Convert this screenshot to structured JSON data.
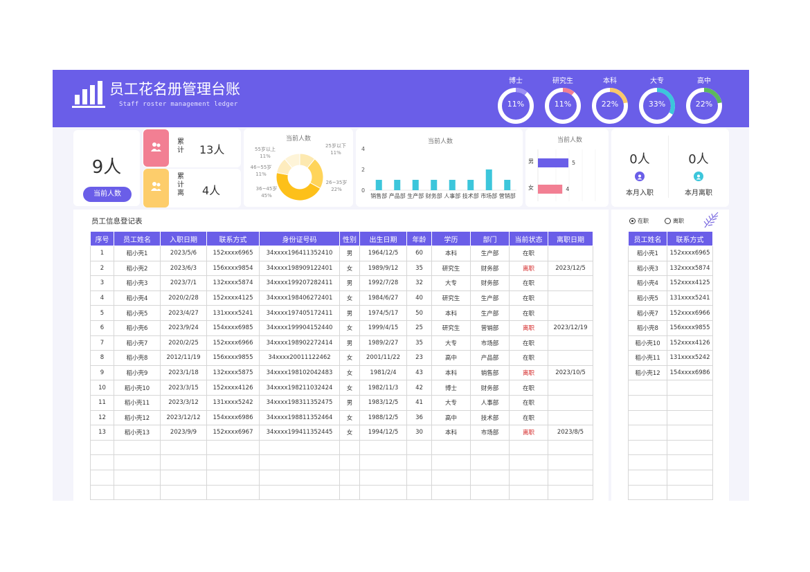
{
  "header": {
    "title": "员工花名册管理台账",
    "subtitle": "Staff roster management ledger"
  },
  "education": [
    {
      "label": "博士",
      "pct_text": "11%",
      "pct": 0.11,
      "color": "#9c8ff5"
    },
    {
      "label": "研究生",
      "pct_text": "11%",
      "pct": 0.11,
      "color": "#f27f93"
    },
    {
      "label": "本科",
      "pct_text": "22%",
      "pct": 0.22,
      "color": "#f9c86a"
    },
    {
      "label": "大专",
      "pct_text": "33%",
      "pct": 0.33,
      "color": "#3cc6db"
    },
    {
      "label": "高中",
      "pct_text": "22%",
      "pct": 0.22,
      "color": "#5cb85c"
    }
  ],
  "summary": {
    "current_count": "9人",
    "current_label": "当前人数",
    "cum_label": "累计",
    "cum_value": "13人",
    "cum_left_label": "累计离",
    "cum_left_value": "4人",
    "month_join_value": "0人",
    "month_join_label": "本月入职",
    "month_leave_value": "0人",
    "month_leave_label": "本月离职"
  },
  "colors": {
    "accent": "#6a5ee8",
    "pink": "#f27f93",
    "yellow": "#fdcd6b",
    "cyan": "#3cc6db",
    "resign": "#d21f1f"
  },
  "age_chart": {
    "title": "当前人数",
    "labels": [
      {
        "name": "55岁以上",
        "pct": "11%"
      },
      {
        "name": "46~55岁",
        "pct": "11%"
      },
      {
        "name": "36~45岁",
        "pct": "45%"
      },
      {
        "name": "26~35岁",
        "pct": "22%"
      },
      {
        "name": "25岁以下",
        "pct": "11%"
      }
    ]
  },
  "chart_data": [
    {
      "type": "pie",
      "title": "当前人数",
      "categories": [
        "25岁以下",
        "26~35岁",
        "36~45岁",
        "46~55岁",
        "55岁以上"
      ],
      "values": [
        11,
        22,
        45,
        11,
        11
      ]
    },
    {
      "type": "bar",
      "title": "当前人数",
      "categories": [
        "销售部",
        "产品部",
        "生产部",
        "财务部",
        "人事部",
        "技术部",
        "市场部",
        "营销部"
      ],
      "values": [
        1,
        1,
        1,
        1,
        1,
        1,
        2,
        1
      ],
      "ylim": [
        0,
        4
      ],
      "yticks": [
        "0",
        "2",
        "4"
      ],
      "color": "#3cc6db"
    },
    {
      "type": "bar",
      "title": "当前人数",
      "categories": [
        "男",
        "女"
      ],
      "values": [
        5,
        4
      ],
      "colors": [
        "#6a5ee8",
        "#f27f93"
      ],
      "orientation": "horizontal"
    }
  ],
  "register": {
    "title": "员工信息登记表",
    "columns": [
      "序号",
      "员工姓名",
      "入职日期",
      "联系方式",
      "身份证号码",
      "性别",
      "出生日期",
      "年龄",
      "学历",
      "部门",
      "当前状态",
      "离职日期"
    ],
    "rows": [
      [
        "1",
        "稻小壳1",
        "2023/5/6",
        "152xxxx6965",
        "34xxxx196411352410",
        "男",
        "1964/12/5",
        "60",
        "本科",
        "生产部",
        "在职",
        ""
      ],
      [
        "2",
        "稻小壳2",
        "2023/6/3",
        "156xxxx9854",
        "34xxxx198909122401",
        "女",
        "1989/9/12",
        "35",
        "研究生",
        "财务部",
        "离职",
        "2023/12/5"
      ],
      [
        "3",
        "稻小壳3",
        "2023/7/1",
        "132xxxx5874",
        "34xxxx199207282411",
        "男",
        "1992/7/28",
        "32",
        "大专",
        "财务部",
        "在职",
        ""
      ],
      [
        "4",
        "稻小壳4",
        "2020/2/28",
        "152xxxx4125",
        "34xxxx198406272401",
        "女",
        "1984/6/27",
        "40",
        "研究生",
        "生产部",
        "在职",
        ""
      ],
      [
        "5",
        "稻小壳5",
        "2023/4/27",
        "131xxxx5241",
        "34xxxx197405172411",
        "男",
        "1974/5/17",
        "50",
        "本科",
        "生产部",
        "在职",
        ""
      ],
      [
        "6",
        "稻小壳6",
        "2023/9/24",
        "154xxxx6985",
        "34xxxx199904152440",
        "女",
        "1999/4/15",
        "25",
        "研究生",
        "营销部",
        "离职",
        "2023/12/19"
      ],
      [
        "7",
        "稻小壳7",
        "2020/2/25",
        "152xxxx6966",
        "34xxxx198902272414",
        "男",
        "1989/2/27",
        "35",
        "大专",
        "市场部",
        "在职",
        ""
      ],
      [
        "8",
        "稻小壳8",
        "2012/11/19",
        "156xxxx9855",
        "34xxxx20011122462",
        "女",
        "2001/11/22",
        "23",
        "高中",
        "产品部",
        "在职",
        ""
      ],
      [
        "9",
        "稻小壳9",
        "2023/1/18",
        "132xxxx5875",
        "34xxxx198102042483",
        "女",
        "1981/2/4",
        "43",
        "本科",
        "销售部",
        "离职",
        "2023/10/5"
      ],
      [
        "10",
        "稻小壳10",
        "2023/3/15",
        "152xxxx4126",
        "34xxxx198211032424",
        "女",
        "1982/11/3",
        "42",
        "博士",
        "财务部",
        "在职",
        ""
      ],
      [
        "11",
        "稻小壳11",
        "2023/3/12",
        "131xxxx5242",
        "34xxxx198311352475",
        "男",
        "1983/12/5",
        "41",
        "大专",
        "人事部",
        "在职",
        ""
      ],
      [
        "12",
        "稻小壳12",
        "2023/12/12",
        "154xxxx6986",
        "34xxxx198811352464",
        "女",
        "1988/12/5",
        "36",
        "高中",
        "技术部",
        "在职",
        ""
      ],
      [
        "13",
        "稻小壳13",
        "2023/9/9",
        "152xxxx6967",
        "34xxxx199411352445",
        "女",
        "1994/12/5",
        "30",
        "本科",
        "市场部",
        "离职",
        "2023/8/5"
      ]
    ],
    "empty_rows": 4
  },
  "side": {
    "radio_active": "在职",
    "radio_other": "离职",
    "columns": [
      "员工姓名",
      "联系方式"
    ],
    "rows": [
      [
        "稻小壳1",
        "152xxxx6965"
      ],
      [
        "稻小壳3",
        "132xxxx5874"
      ],
      [
        "稻小壳4",
        "152xxxx4125"
      ],
      [
        "稻小壳5",
        "131xxxx5241"
      ],
      [
        "稻小壳7",
        "152xxxx6966"
      ],
      [
        "稻小壳8",
        "156xxxx9855"
      ],
      [
        "稻小壳10",
        "152xxxx4126"
      ],
      [
        "稻小壳11",
        "131xxxx5242"
      ],
      [
        "稻小壳12",
        "154xxxx6986"
      ]
    ],
    "empty_rows": 8
  }
}
